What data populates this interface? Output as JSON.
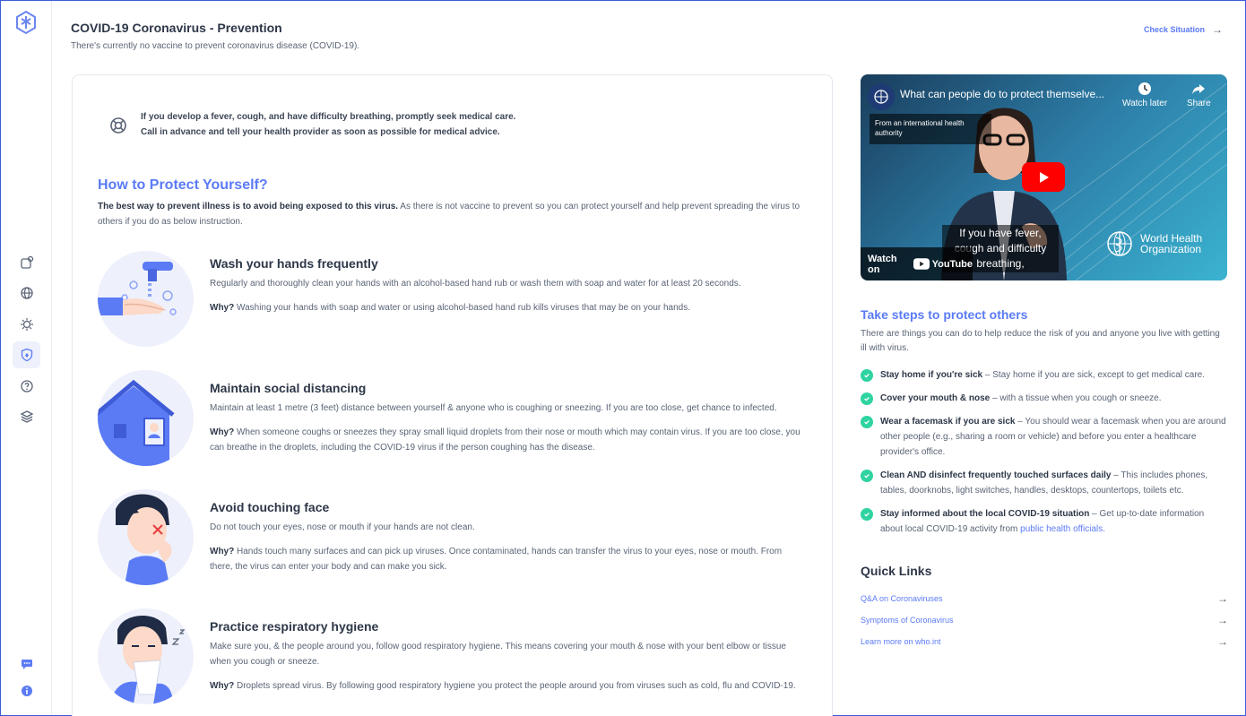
{
  "header": {
    "title": "COVID-19 Coronavirus - Prevention",
    "subtitle": "There's currently no vaccine to prevent coronavirus disease (COVID-19).",
    "check_situation": "Check Situation"
  },
  "sidebar": {
    "items": [
      {
        "icon": "cards-icon"
      },
      {
        "icon": "globe-icon"
      },
      {
        "icon": "virus-icon"
      },
      {
        "icon": "shield-icon",
        "active": true
      },
      {
        "icon": "help-icon"
      },
      {
        "icon": "layers-icon"
      }
    ],
    "bottom": [
      {
        "icon": "chat-icon"
      },
      {
        "icon": "info-icon"
      }
    ]
  },
  "alert": {
    "line1": "If you develop a fever, cough, and have difficulty breathing, promptly seek medical care.",
    "line2": "Call in advance and tell your health provider as soon as possible for medical advice."
  },
  "howto": {
    "title": "How to Protect Yourself?",
    "intro_bold": "The best way to prevent illness is to avoid being exposed to this virus.",
    "intro_rest": " As there is not vaccine to prevent so you can protect yourself and help prevent spreading the virus to others if you do as below instruction.",
    "why_label": "Why?",
    "steps": [
      {
        "title": "Wash your hands frequently",
        "desc": "Regularly and thoroughly clean your hands with an alcohol-based hand rub or wash them with soap and water for at least 20 seconds.",
        "why": " Washing your hands with soap and water or using alcohol-based hand rub kills viruses that may be on your hands."
      },
      {
        "title": "Maintain social distancing",
        "desc": "Maintain at least 1 metre (3 feet) distance between yourself & anyone who is coughing or sneezing. If you are too close, get chance to infected.",
        "why": " When someone coughs or sneezes they spray small liquid droplets from their nose or mouth which may contain virus. If you are too close, you can breathe in the droplets, including the COVID-19 virus if the person coughing has the disease."
      },
      {
        "title": "Avoid touching face",
        "desc": "Do not touch your eyes, nose or mouth if your hands are not clean.",
        "why": " Hands touch many surfaces and can pick up viruses. Once contaminated, hands can transfer the virus to your eyes, nose or mouth. From there, the virus can enter your body and can make you sick."
      },
      {
        "title": "Practice respiratory hygiene",
        "desc": "Make sure you, & the people around you, follow good respiratory hygiene. This means covering your mouth & nose with your bent elbow or tissue when you cough or sneeze.",
        "why": " Droplets spread virus. By following good respiratory hygiene you protect the people around you from viruses such as cold, flu and COVID-19."
      }
    ]
  },
  "video": {
    "title": "What can people do to protect themselve...",
    "from_badge": "From an international health authority",
    "watch_later": "Watch later",
    "share": "Share",
    "caption": "If you have fever, cough and difficulty breathing,",
    "watch_on": "Watch on",
    "youtube": "YouTube",
    "who_line1": "World Health",
    "who_line2": "Organization"
  },
  "protect_others": {
    "title": "Take steps to protect others",
    "intro": "There are things you can do to help reduce the risk of you and anyone you live with getting ill with virus.",
    "items": [
      {
        "bold": "Stay home if you're sick",
        "text": " – Stay home if you are sick, except to get medical care.",
        "link": ""
      },
      {
        "bold": "Cover your mouth & nose",
        "text": " – with a tissue when you cough or sneeze.",
        "link": ""
      },
      {
        "bold": "Wear a facemask if you are sick",
        "text": " – You should wear a facemask when you are around other people (e.g., sharing a room or vehicle) and before you enter a healthcare provider's office.",
        "link": ""
      },
      {
        "bold": "Clean AND disinfect frequently touched surfaces daily",
        "text": " – This includes phones, tables, doorknobs, light switches, handles, desktops, countertops, toilets etc.",
        "link": ""
      },
      {
        "bold": "Stay informed about the local COVID-19 situation",
        "text": " – Get up-to-date information about local COVID-19 activity from ",
        "link": "public health officials."
      }
    ]
  },
  "quick_links": {
    "title": "Quick Links",
    "items": [
      {
        "label": "Q&A on Coronaviruses"
      },
      {
        "label": "Symptoms of Coronavirus"
      },
      {
        "label": "Learn more on who.int"
      }
    ]
  },
  "colors": {
    "accent": "#5b7bf5",
    "check": "#2fd3a1",
    "youtube_red": "#ff0000"
  }
}
